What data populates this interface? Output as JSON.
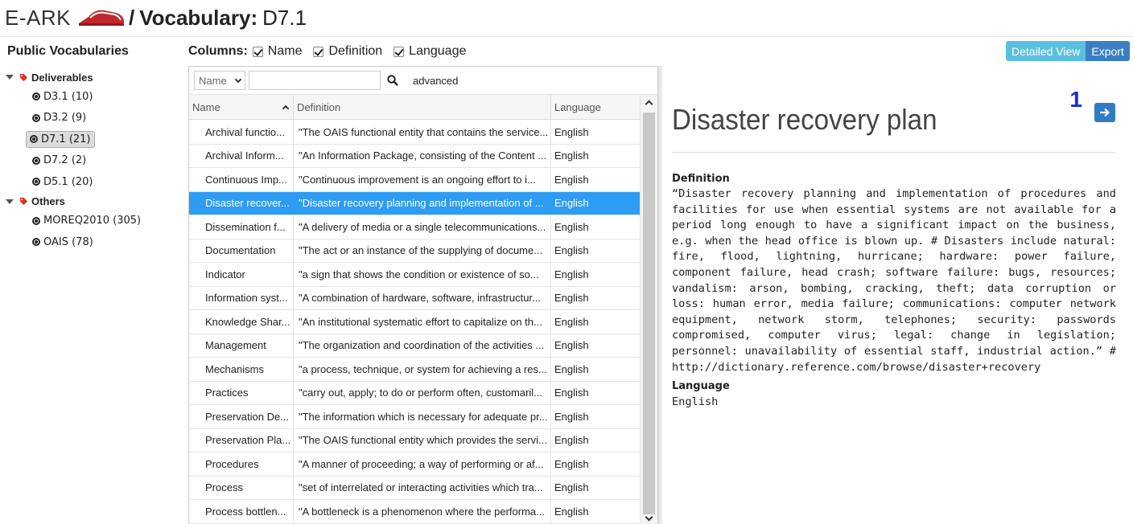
{
  "header": {
    "brand": "E-ARK",
    "separator": "/",
    "crumb_label": "Vocabulary:",
    "crumb_value": "D7.1",
    "brand_color": "#c1272d"
  },
  "sidebar": {
    "title": "Public Vocabularies",
    "groups": [
      {
        "label": "Deliverables",
        "items": [
          {
            "label": "D3.1 (10)"
          },
          {
            "label": "D3.2 (9)"
          },
          {
            "label": "D7.1 (21)",
            "selected": true
          },
          {
            "label": "D7.2 (2)"
          },
          {
            "label": "D5.1 (20)"
          }
        ]
      },
      {
        "label": "Others",
        "items": [
          {
            "label": "MOREQ2010 (305)"
          },
          {
            "label": "OAIS (78)"
          }
        ]
      }
    ]
  },
  "columns_bar": {
    "label": "Columns:",
    "options": [
      {
        "label": "Name",
        "checked": true
      },
      {
        "label": "Definition",
        "checked": true
      },
      {
        "label": "Language",
        "checked": true
      }
    ]
  },
  "toolbar_buttons": {
    "detailed_view": "Detailed View",
    "export": "Export"
  },
  "grid": {
    "search": {
      "field_value": "Name",
      "query": "",
      "advanced_label": "advanced"
    },
    "headers": {
      "name": "Name",
      "definition": "Definition",
      "language": "Language"
    },
    "rows": [
      {
        "name": "Archival functio...",
        "definition": "\"The OAIS functional entity that contains the service...",
        "language": "English"
      },
      {
        "name": "Archival Inform...",
        "definition": "\"An Information Package, consisting of the Content ...",
        "language": "English"
      },
      {
        "name": "Continuous Imp...",
        "definition": "\"Continuous improvement is an ongoing effort to i...",
        "language": "English"
      },
      {
        "name": "Disaster recover...",
        "definition": "\"Disaster recovery planning and implementation of ...",
        "language": "English",
        "selected": true
      },
      {
        "name": "Dissemination f...",
        "definition": "\"A delivery of media or a single telecommunications...",
        "language": "English"
      },
      {
        "name": "Documentation",
        "definition": "\"The act or an instance of the supplying of docume...",
        "language": "English"
      },
      {
        "name": "Indicator",
        "definition": "\"a sign that shows the condition or existence of so...",
        "language": "English"
      },
      {
        "name": "Information syst...",
        "definition": "\"A combination of hardware, software, infrastructur...",
        "language": "English"
      },
      {
        "name": "Knowledge Shar...",
        "definition": "\"An institutional systematic effort to capitalize on th...",
        "language": "English"
      },
      {
        "name": "Management",
        "definition": "\"The organization and coordination of the activities ...",
        "language": "English"
      },
      {
        "name": "Mechanisms",
        "definition": "\"a process, technique, or system for achieving a res...",
        "language": "English"
      },
      {
        "name": "Practices",
        "definition": "\"carry out, apply; to do or perform often, customaril...",
        "language": "English"
      },
      {
        "name": "Preservation De...",
        "definition": "\"The information which is necessary for adequate pr...",
        "language": "English"
      },
      {
        "name": "Preservation Pla...",
        "definition": "\"The OAIS functional entity which provides the servi...",
        "language": "English"
      },
      {
        "name": "Procedures",
        "definition": "\"A manner of proceeding; a way of performing or af...",
        "language": "English"
      },
      {
        "name": "Process",
        "definition": "\"set of interrelated or interacting activities which tra...",
        "language": "English"
      },
      {
        "name": "Process bottlen...",
        "definition": "\"A bottleneck is a phenomenon where the performa...",
        "language": "English"
      }
    ]
  },
  "detail": {
    "title": "Disaster recovery plan",
    "index": "1",
    "definition_label": "Definition",
    "definition_text": "“Disaster recovery planning and implementation of procedures and facilities for use when essential systems are not available for a period long enough to have a significant impact on the business, e.g. when the head office is blown up. # Disasters include natural: fire, flood, lightning, hurricane; hardware: power failure, component failure, head crash; software failure: bugs, resources; vandalism: arson, bombing, cracking, theft; data corruption or loss: human error, media failure; communications: computer network equipment, network storm, telephones; security: passwords compromised, computer virus; legal: change in legislation; personnel: unavailability of essential staff, industrial action.” # http://dictionary.reference.com/browse/disaster+recovery",
    "language_label": "Language",
    "language_value": "English"
  },
  "icons": {
    "logo": "earkflag-logo-icon",
    "tag": "tag-icon",
    "globe": "globe-icon",
    "search": "search-icon",
    "next": "arrow-right-icon"
  }
}
